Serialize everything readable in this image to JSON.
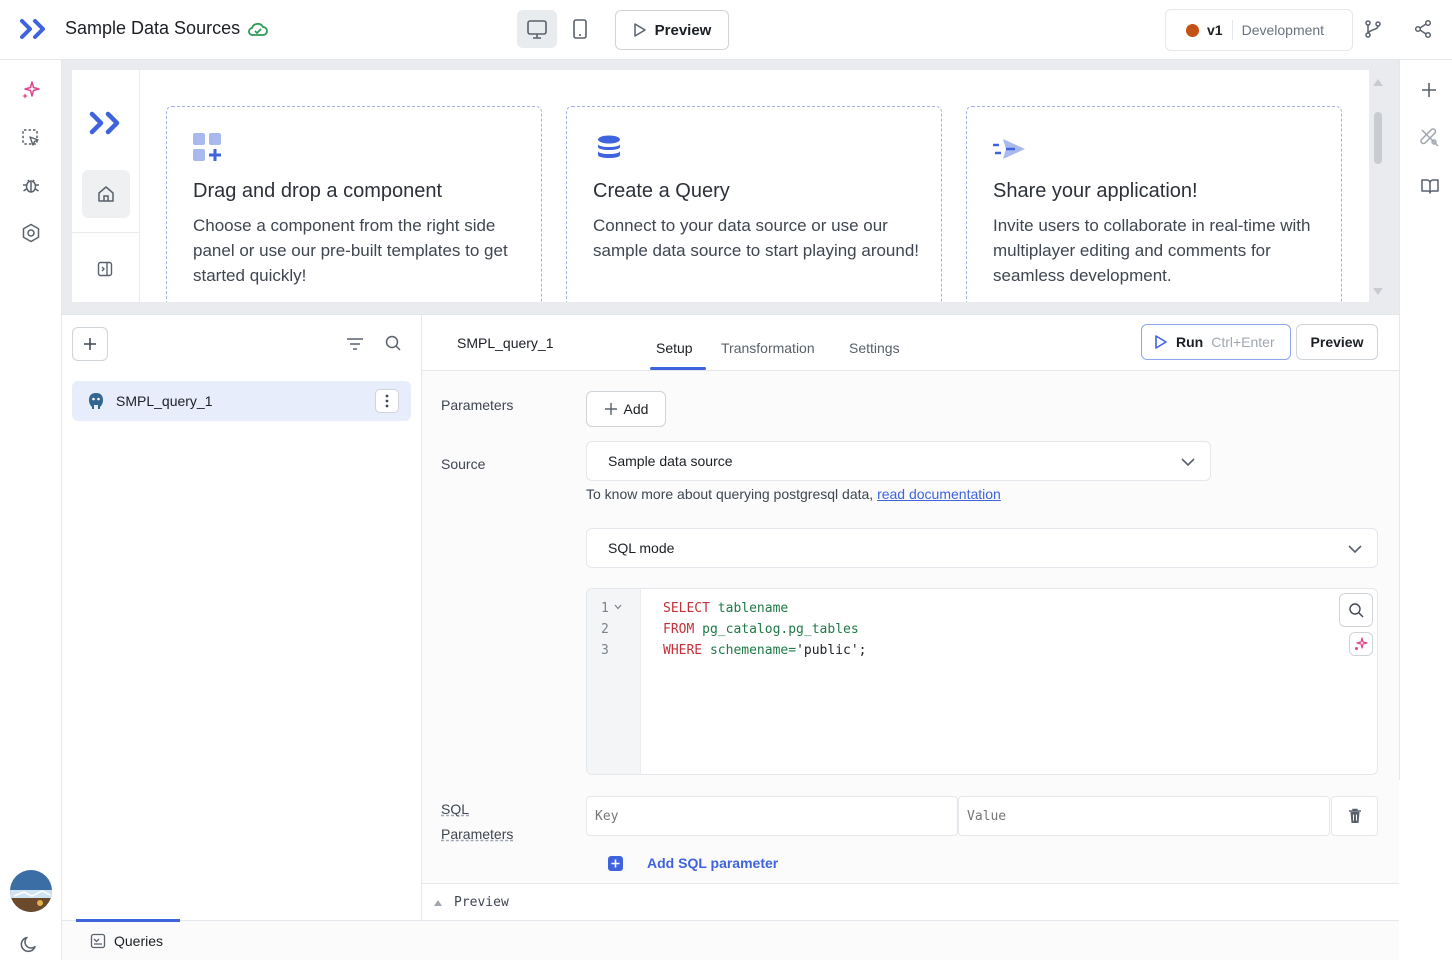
{
  "header": {
    "title": "Sample Data Sources",
    "preview_label": "Preview",
    "version": "v1",
    "environment": "Development"
  },
  "canvas": {
    "cards": [
      {
        "title": "Drag and drop a component",
        "description": "Choose a component from the right side panel or use our pre-built templates to get started quickly!"
      },
      {
        "title": "Create a Query",
        "description": "Connect to your data source or use our sample data source to start playing around!"
      },
      {
        "title": "Share your application!",
        "description": "Invite users to collaborate in real-time with multiplayer editing and comments for seamless development."
      }
    ]
  },
  "query_list": {
    "items": [
      {
        "name": "SMPL_query_1"
      }
    ]
  },
  "editor": {
    "query_name": "SMPL_query_1",
    "tabs": [
      "Setup",
      "Transformation",
      "Settings"
    ],
    "active_tab": "Setup",
    "run_label": "Run",
    "run_shortcut": "Ctrl+Enter",
    "preview_label": "Preview",
    "parameters_label": "Parameters",
    "add_label": "Add",
    "source_label": "Source",
    "source_value": "Sample data source",
    "hint_text": "To know more about querying postgresql data,",
    "hint_link": "read documentation",
    "mode_value": "SQL mode",
    "code": {
      "line_numbers": [
        "1",
        "2",
        "3"
      ],
      "lines": [
        {
          "kw": "SELECT",
          "rest": "tablename"
        },
        {
          "kw": "FROM",
          "rest": "pg_catalog.pg_tables"
        },
        {
          "kw": "WHERE",
          "rest": "schemename=",
          "str": "'public';"
        }
      ]
    },
    "sql_params_label_1": "SQL",
    "sql_params_label_2": "Parameters",
    "key_placeholder": "Key",
    "value_placeholder": "Value",
    "add_sql_param_label": "Add SQL parameter",
    "preview_panel_label": "Preview"
  },
  "bottom_bar": {
    "tab_label": "Queries"
  },
  "colors": {
    "accent": "#3e63dd",
    "env_dot": "#c45115",
    "ai_pink": "#e0468c"
  }
}
